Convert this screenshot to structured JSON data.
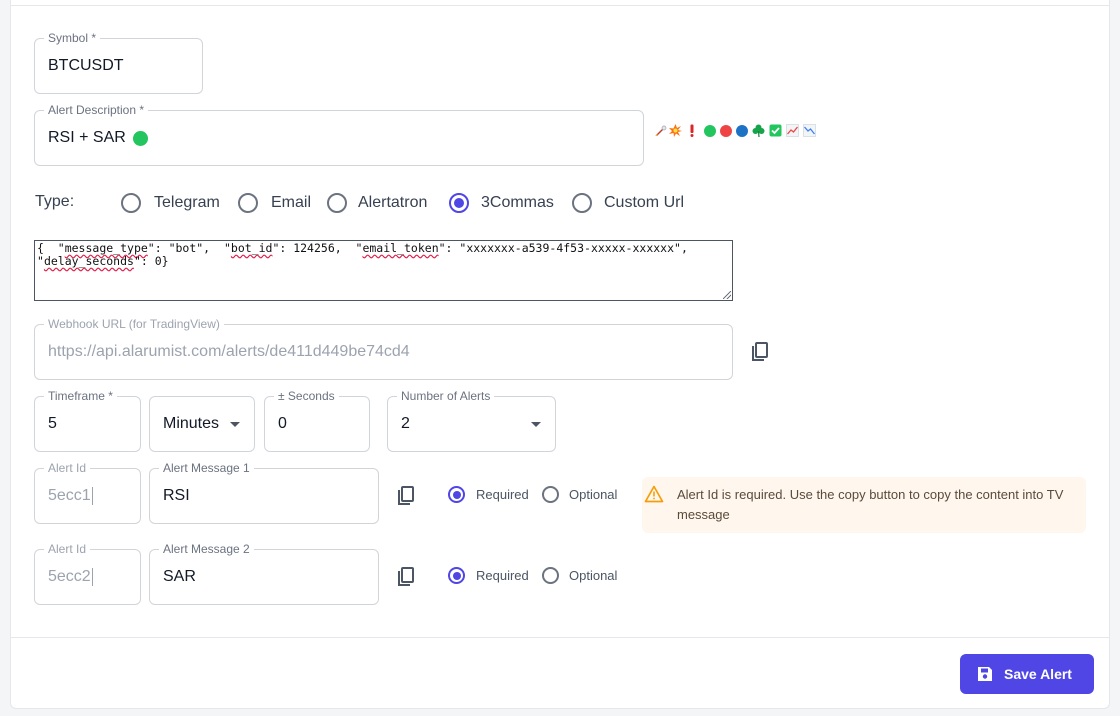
{
  "symbol": {
    "label": "Symbol *",
    "value": "BTCUSDT"
  },
  "description": {
    "label": "Alert Description *",
    "value": "RSI + SAR",
    "emoji_icons": [
      "rocket-icon",
      "explosion-icon",
      "exclamation-icon",
      "green-circle-icon",
      "red-circle-icon",
      "blue-circle-icon",
      "shamrock-icon",
      "check-box-icon",
      "chart-up-icon",
      "chart-down-icon"
    ]
  },
  "type": {
    "label": "Type:",
    "options": [
      {
        "label": "Telegram",
        "selected": false
      },
      {
        "label": "Email",
        "selected": false
      },
      {
        "label": "Alertatron",
        "selected": false
      },
      {
        "label": "3Commas",
        "selected": true
      },
      {
        "label": "Custom Url",
        "selected": false
      }
    ]
  },
  "json_message": {
    "p1": "{  \"",
    "k1": "message_type",
    "p2": "\": \"bot\",  \"",
    "k2": "bot_id",
    "p3": "\": 124256,  \"",
    "k3": "email_token",
    "p4": "\": \"xxxxxxx-a539-4f53-xxxxx-xxxxxx\",",
    "p5": "\"",
    "k4": "delay_seconds",
    "p6": "\": 0}"
  },
  "webhook": {
    "label": "Webhook URL (for TradingView)",
    "value": "https://api.alarumist.com/alerts/de411d449be74cd4"
  },
  "timeframe": {
    "label": "Timeframe *",
    "value": "5"
  },
  "unit": {
    "value": "Minutes"
  },
  "seconds": {
    "label": "± Seconds",
    "value": "0"
  },
  "num_alerts": {
    "label": "Number of Alerts",
    "value": "2"
  },
  "alerts": [
    {
      "id_label": "Alert Id",
      "id_value": "5ecc1",
      "msg_label": "Alert Message 1",
      "msg_value": "RSI",
      "required_label": "Required",
      "optional_label": "Optional",
      "required": true
    },
    {
      "id_label": "Alert Id",
      "id_value": "5ecc2",
      "msg_label": "Alert Message 2",
      "msg_value": "SAR",
      "required_label": "Required",
      "optional_label": "Optional",
      "required": true
    }
  ],
  "warning": "Alert Id is required. Use the copy button to copy the content into TV message",
  "save_label": "Save Alert",
  "colors": {
    "accent": "#4f46e5",
    "warning_bg": "#fff7ed",
    "warning_icon": "#f59e0b",
    "status_green": "#22c55e"
  }
}
